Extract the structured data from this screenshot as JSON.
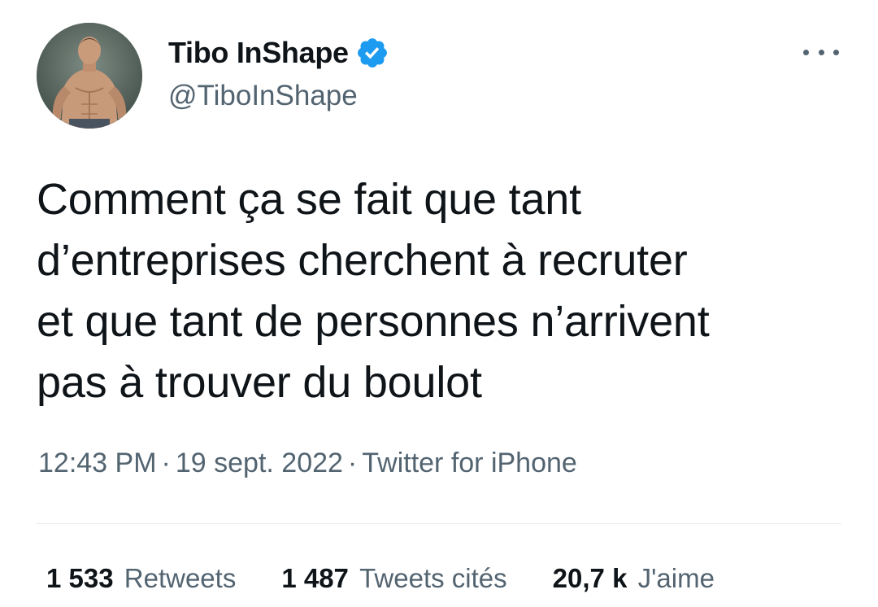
{
  "author": {
    "display_name": "Tibo InShape",
    "handle": "@TiboInShape",
    "verified": true,
    "avatar_icon": "profile-photo"
  },
  "tweet": {
    "text_lines": [
      "Comment ça se fait que tant",
      "d’entreprises cherchent à recruter",
      "et que tant de personnes n’arrivent",
      "pas à trouver du boulot"
    ],
    "time": "12:43 PM",
    "date": "19 sept. 2022",
    "source": "Twitter for iPhone",
    "separator": "·"
  },
  "stats": {
    "retweets_count": "1 533",
    "retweets_label": "Retweets",
    "quotes_count": "1 487",
    "quotes_label": "Tweets cités",
    "likes_count": "20,7 k",
    "likes_label": "J'aime"
  },
  "colors": {
    "text_primary": "#0f1419",
    "text_secondary": "#536471",
    "verified_blue": "#1d9bf0",
    "divider": "#e6ecf0"
  },
  "icons": {
    "more": "more-horizontal-icon",
    "verified": "verified-badge-icon"
  }
}
